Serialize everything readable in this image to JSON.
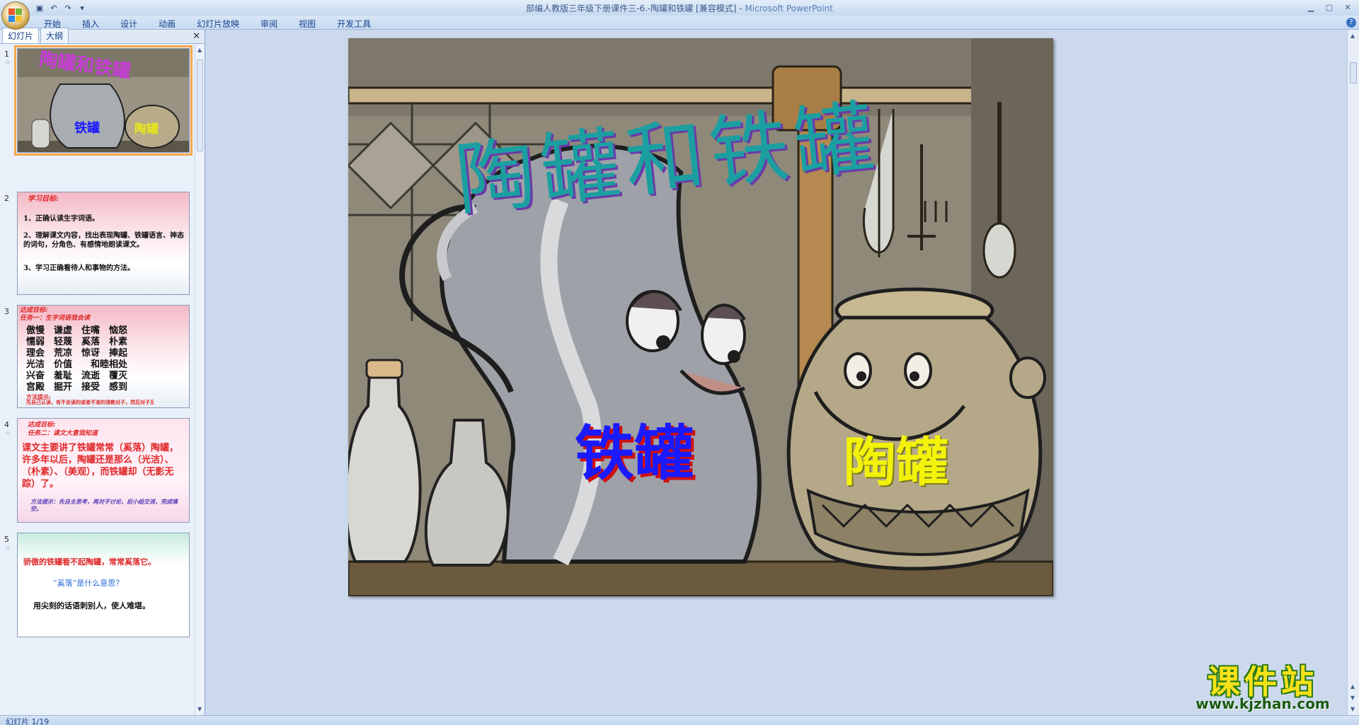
{
  "window": {
    "title": "部编人教版三年级下册课件三-6.-陶罐和铁罐 [兼容模式]",
    "app_name": "Microsoft PowerPoint"
  },
  "ribbon": {
    "tabs": [
      "开始",
      "插入",
      "设计",
      "动画",
      "幻灯片放映",
      "审阅",
      "视图",
      "开发工具"
    ]
  },
  "left_pane": {
    "tabs": [
      "幻灯片",
      "大纲"
    ]
  },
  "slides": [
    {
      "number": "1",
      "title": "陶罐和铁罐",
      "label_iron": "铁罐",
      "label_clay": "陶罐"
    },
    {
      "number": "2",
      "heading": "学习目标:",
      "lines": [
        "1、正确认读生字词语。",
        "2、理解课文内容，找出表现陶罐、铁罐语言、神态的词句，分角色、有感情地朗读课文。",
        "3、学习正确看待人和事物的方法。"
      ]
    },
    {
      "number": "3",
      "heading": "达成目标:",
      "subheading": "任务一：生字词语我会读",
      "rows": [
        "傲慢　谦虚　住嘴　恼怒",
        "懦弱　轻蔑　奚落　朴素",
        "理会　荒凉　惊讶　捧起",
        "光洁　价值　　和睦相处",
        "兴奋　羞耻　流逝　覆灭",
        "宫殿　掘开　接受　感到"
      ],
      "tip_title": "方法提示:",
      "tip": "先自己认读，有不会读的或者不准的请教对子，然后对子互查。"
    },
    {
      "number": "4",
      "heading": "达成目标:",
      "subheading": "任务二：课文大意我知道",
      "body": "课文主要讲了铁罐常常（奚落）陶罐，许多年以后，陶罐还是那么（光洁）、（朴素）、（美观），而铁罐却（无影无踪）了。",
      "tip": "方法提示：先自主思考，再对子讨论，后小组交流，完成填空。"
    },
    {
      "number": "5",
      "line1": "骄傲的铁罐看不起陶罐，常常奚落它。",
      "line2": "“奚落”是什么意思？",
      "line3": "用尖刻的话语刺别人，使人难堪。"
    }
  ],
  "status": {
    "slide_indicator": "幻灯片 1/19"
  },
  "watermark": {
    "text": "课件站",
    "url": "www.kjzhan.com"
  },
  "colors": {
    "ribbon_bg": "#c7daf1",
    "accent_orange": "#f5a64a",
    "title_art": "#1b9fa0",
    "iron_label": "#1a1aff",
    "clay_label": "#f2f20a"
  }
}
